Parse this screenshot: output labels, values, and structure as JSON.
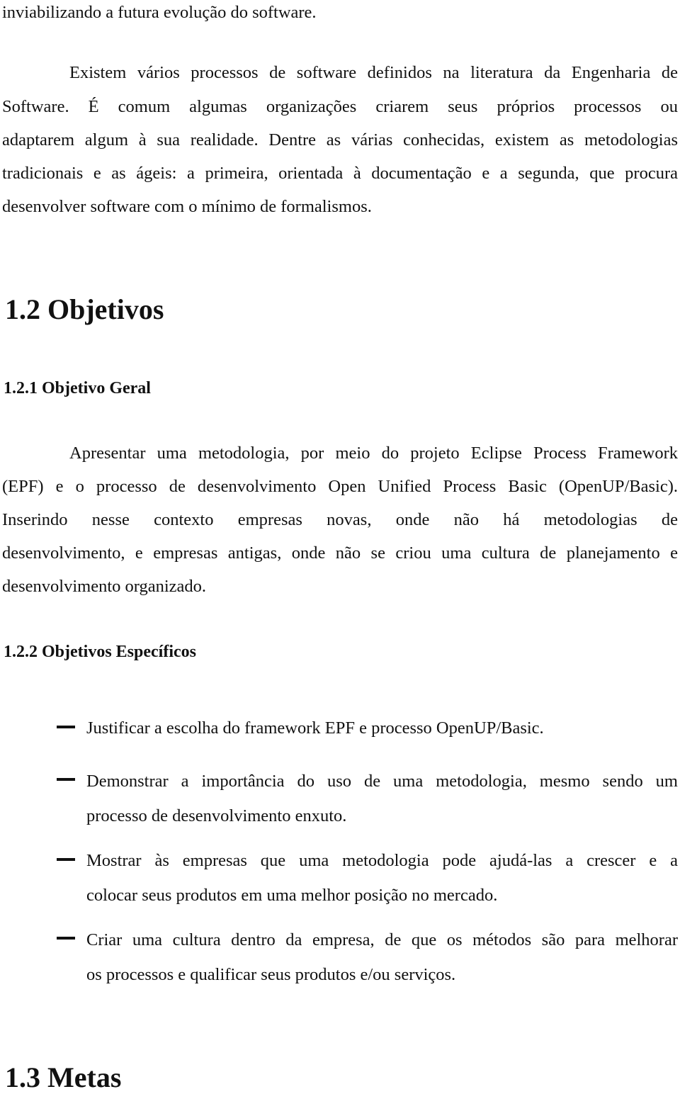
{
  "document": {
    "intro_tail": "inviabilizando a futura evolução do software.",
    "paragraph1_lines": [
      "Existem vários processos de software definidos na literatura da Engenharia de",
      "Software. É comum algumas organizações criarem seus próprios processos ou",
      "adaptarem algum à sua realidade. Dentre as várias conhecidas, existem as metodologias",
      "tradicionais e as ágeis: a primeira, orientada à documentação e a segunda, que procura",
      "desenvolver software com o mínimo de formalismos."
    ],
    "section_1_2": "1.2 Objetivos",
    "section_1_2_1": "1.2.1 Objetivo Geral",
    "paragraph2_lines": [
      "Apresentar uma metodologia, por meio do projeto Eclipse Process Framework",
      "(EPF) e o processo de desenvolvimento Open Unified Process Basic (OpenUP/Basic).",
      "Inserindo nesse contexto empresas novas, onde não há metodologias de",
      "desenvolvimento, e empresas antigas, onde não se criou uma cultura de planejamento e",
      "desenvolvimento organizado."
    ],
    "section_1_2_2": "1.2.2 Objetivos Específicos",
    "objectives": [
      {
        "lines": [
          "Justificar a escolha do framework EPF e processo OpenUP/Basic."
        ]
      },
      {
        "lines": [
          "Demonstrar a importância do uso de uma metodologia, mesmo sendo um",
          "processo de desenvolvimento enxuto."
        ]
      },
      {
        "lines": [
          "Mostrar às empresas que uma metodologia pode ajudá-las a crescer e a",
          "colocar seus produtos em uma melhor posição no mercado."
        ]
      },
      {
        "lines": [
          "Criar uma cultura dentro da empresa, de que os métodos são para melhorar",
          "os processos e qualificar seus produtos e/ou serviços."
        ]
      }
    ],
    "section_1_3": "1.3 Metas"
  }
}
